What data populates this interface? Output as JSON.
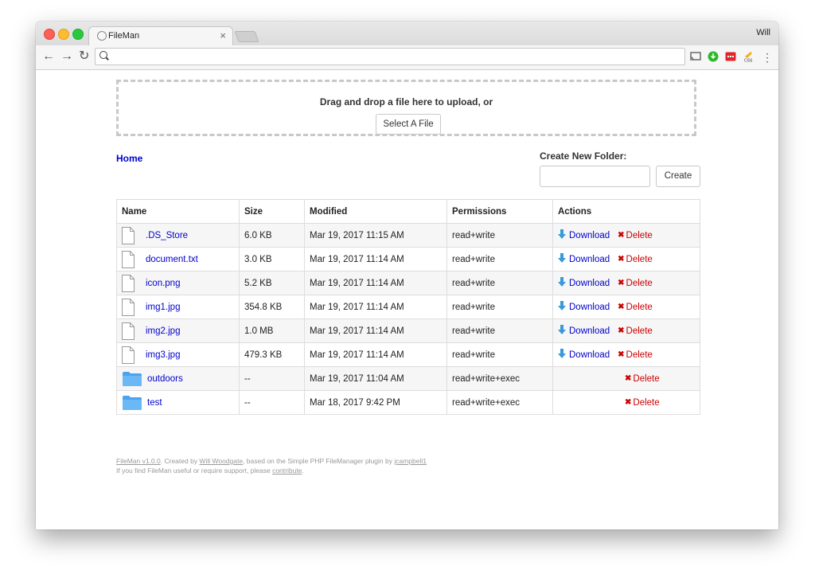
{
  "browser": {
    "tab_title": "FileMan",
    "tab_close": "×",
    "user": "Will",
    "nav": {
      "back": "←",
      "forward": "→",
      "reload": "↻"
    },
    "menu_glyph": "⋮"
  },
  "upload": {
    "prompt": "Drag and drop a file here to upload, or",
    "select_label": "Select A File"
  },
  "breadcrumb": {
    "home": "Home"
  },
  "new_folder": {
    "label": "Create New Folder:",
    "button": "Create",
    "value": ""
  },
  "table": {
    "headers": [
      "Name",
      "Size",
      "Modified",
      "Permissions",
      "Actions"
    ],
    "download_label": "Download",
    "delete_label": "Delete",
    "rows": [
      {
        "name": ".DS_Store",
        "size": "6.0 KB",
        "modified": "Mar 19, 2017 11:15 AM",
        "permissions": "read+write",
        "type": "file"
      },
      {
        "name": "document.txt",
        "size": "3.0 KB",
        "modified": "Mar 19, 2017 11:14 AM",
        "permissions": "read+write",
        "type": "file"
      },
      {
        "name": "icon.png",
        "size": "5.2 KB",
        "modified": "Mar 19, 2017 11:14 AM",
        "permissions": "read+write",
        "type": "file"
      },
      {
        "name": "img1.jpg",
        "size": "354.8 KB",
        "modified": "Mar 19, 2017 11:14 AM",
        "permissions": "read+write",
        "type": "file"
      },
      {
        "name": "img2.jpg",
        "size": "1.0 MB",
        "modified": "Mar 19, 2017 11:14 AM",
        "permissions": "read+write",
        "type": "file"
      },
      {
        "name": "img3.jpg",
        "size": "479.3 KB",
        "modified": "Mar 19, 2017 11:14 AM",
        "permissions": "read+write",
        "type": "file"
      },
      {
        "name": "outdoors",
        "size": "--",
        "modified": "Mar 19, 2017 11:04 AM",
        "permissions": "read+write+exec",
        "type": "folder"
      },
      {
        "name": "test",
        "size": "--",
        "modified": "Mar 18, 2017 9:42 PM",
        "permissions": "read+write+exec",
        "type": "folder"
      }
    ]
  },
  "footer": {
    "app_link": "FileMan v1.0.0",
    "created_by": ". Created by ",
    "author_link": "Will Woodgate",
    "based_on": ", based on the Simple PHP FileManager plugin by ",
    "plugin_author_link": "jcampbell1",
    "line2_prefix": "If you find FileMan useful or require support, please ",
    "contribute_link": "contribute",
    "line2_suffix": "."
  },
  "colors": {
    "link": "#0000cc",
    "delete": "#cc0000",
    "download_icon": "#3a9ad9",
    "folder": "#4aa3f0"
  },
  "icons": {
    "file": "file-icon",
    "folder": "folder-icon",
    "download": "download-arrow-icon",
    "delete": "delete-x-icon"
  }
}
